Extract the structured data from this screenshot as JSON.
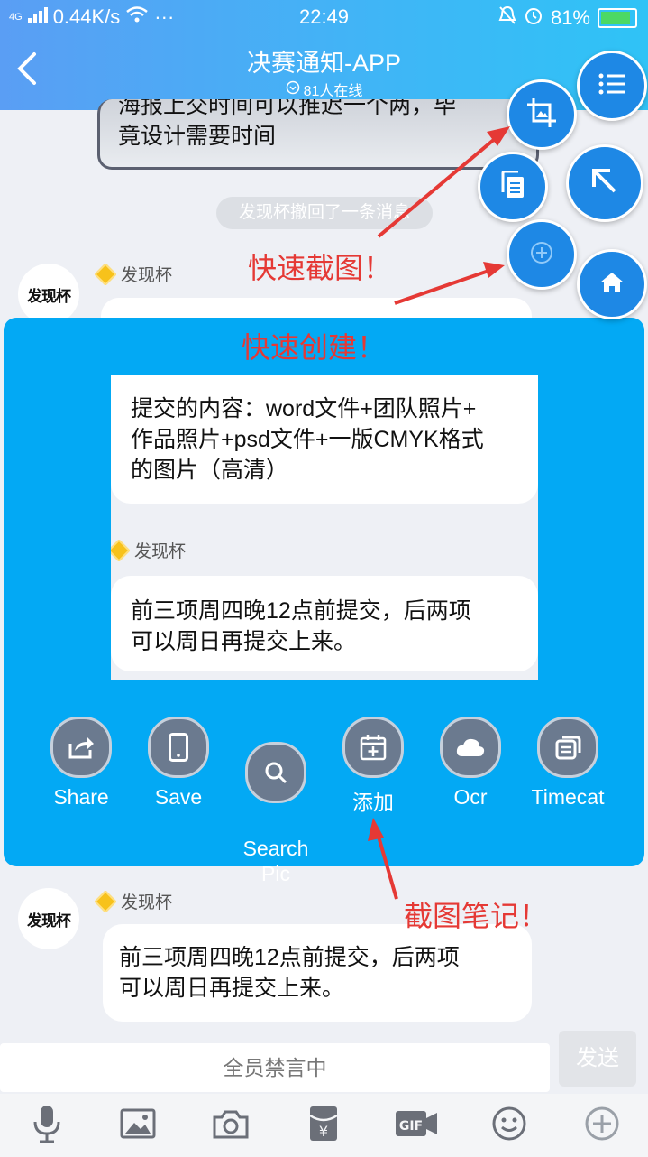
{
  "status_bar": {
    "network": "4G",
    "speed": "0.44K/s",
    "dots": "···",
    "time": "22:49",
    "battery": "81%",
    "battery_level": 0.81
  },
  "header": {
    "title": "决赛通知-APP",
    "online": "81人在线"
  },
  "chat": {
    "partial_message": "海报上交时间可以推迟一个两，毕竟设计需要时间",
    "partial_line1": "海报上交时间可以推迟一个两，毕",
    "partial_line2": "竟设计需要时间",
    "recall_notice": "发现杯撤回了一条消息",
    "sender": "发现杯",
    "avatar_text": "发现杯",
    "message_1_lines": [
      "提交的内容：word文件+团队照片+",
      "作品照片+psd文件+一版CMYK格式",
      "的图片（高清）"
    ],
    "message_2_lines": [
      "前三项周四晚12点前提交，后两项",
      "可以周日再提交上来。"
    ]
  },
  "panel": {
    "actions": [
      {
        "label": "Share",
        "icon": "share-icon"
      },
      {
        "label": "Save",
        "icon": "phone-icon"
      },
      {
        "label": "Search\nPic",
        "icon": "search-icon"
      },
      {
        "label": "添加",
        "icon": "calendar-add-icon"
      },
      {
        "label": "Ocr",
        "icon": "cloud-icon"
      },
      {
        "label": "Timecat",
        "icon": "timecat-icon"
      }
    ]
  },
  "annotations": {
    "quick_screenshot": "快速截图！",
    "quick_create": "快速创建！",
    "screenshot_notes": "截图笔记！"
  },
  "input": {
    "placeholder": "全员禁言中",
    "send_label": "发送"
  },
  "toolbar": [
    "mic-icon",
    "image-icon",
    "camera-icon",
    "red-packet-icon",
    "gif-icon",
    "emoji-icon",
    "plus-icon"
  ],
  "colors": {
    "header_start": "#5a9ef4",
    "header_end": "#2fc3f6",
    "panel": "#03a9f4",
    "annotation": "#e53935",
    "fab": "#1e88e5"
  }
}
